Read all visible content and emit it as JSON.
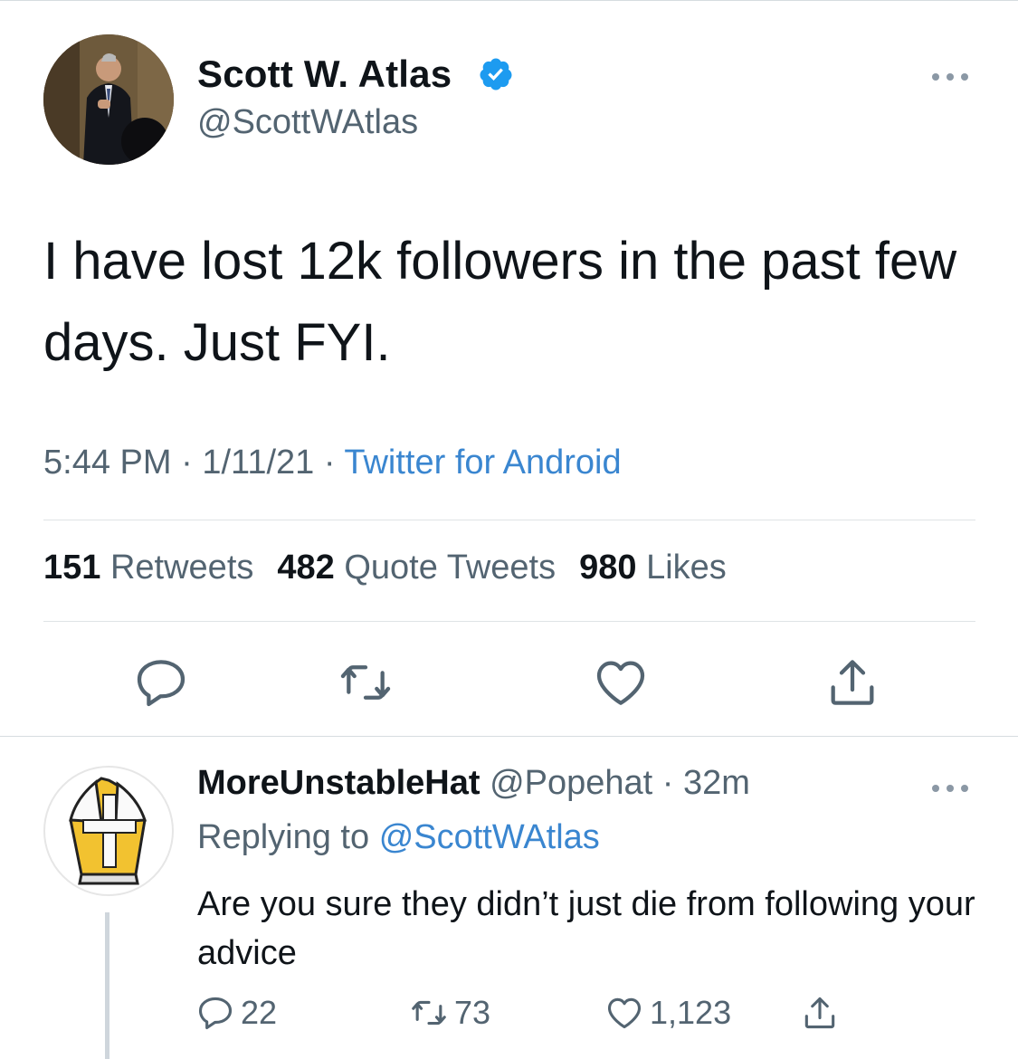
{
  "tweet": {
    "author_name": "Scott W. Atlas",
    "author_handle": "@ScottWAtlas",
    "text": "I have lost 12k followers in the past few days. Just FYI.",
    "time": "5:44 PM",
    "date": "1/11/21",
    "source": "Twitter for Android",
    "stats": {
      "retweets_count": "151",
      "retweets_label": "Retweets",
      "quotes_count": "482",
      "quotes_label": "Quote Tweets",
      "likes_count": "980",
      "likes_label": "Likes"
    },
    "actions": [
      "reply-icon",
      "retweet-icon",
      "like-icon",
      "share-icon"
    ]
  },
  "reply": {
    "author_name": "MoreUnstableHat",
    "author_handle": "@Popehat",
    "age": "32m",
    "replying_label": "Replying to",
    "replying_to": "@ScottWAtlas",
    "text": "Are you sure they didn’t just die from following your advice",
    "reply_count": "22",
    "retweet_count": "73",
    "like_count": "1,123"
  },
  "colors": {
    "link": "#3a86d0",
    "secondary_text": "#536471",
    "verified": "#1d9bf0",
    "mitre_gold": "#f2c230"
  }
}
